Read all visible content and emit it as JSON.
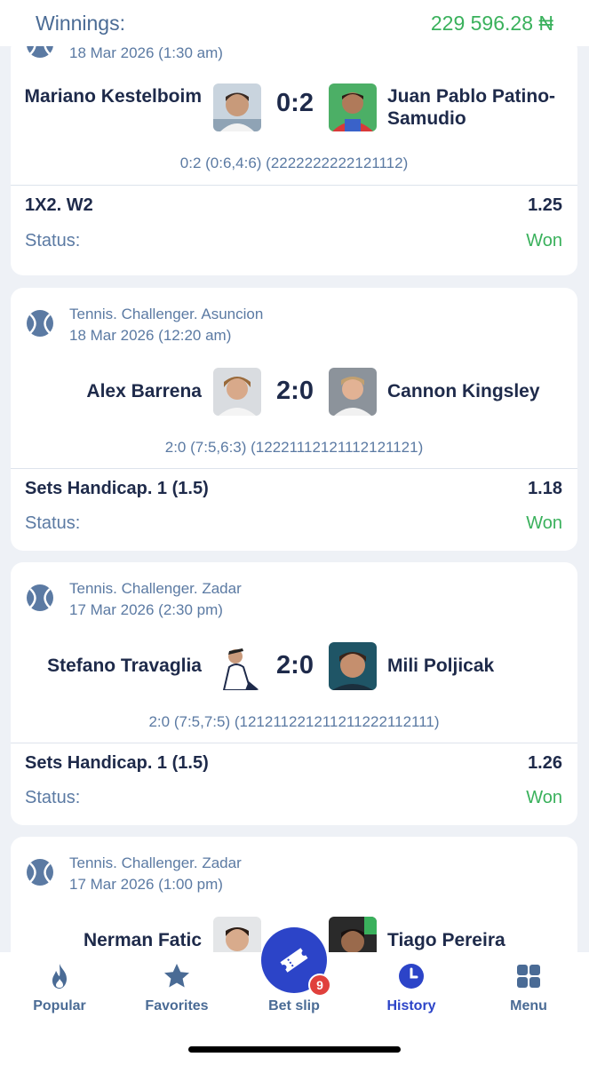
{
  "header": {
    "winnings_label": "Winnings:",
    "winnings_amount": "229 596.28 ₦"
  },
  "bets": [
    {
      "league": "",
      "date": "18 Mar 2026 (1:30 am)",
      "team1": "Mariano Kestelboim",
      "team2": "Juan Pablo Patino-Samudio",
      "score": "0:2",
      "details": "0:2 (0:6,4:6) (2222222222121112)",
      "market": "1X2. W2",
      "odds": "1.25",
      "status_label": "Status:",
      "status_value": "Won"
    },
    {
      "league": "Tennis. Challenger. Asuncion",
      "date": "18 Mar 2026 (12:20 am)",
      "team1": "Alex Barrena",
      "team2": "Cannon Kingsley",
      "score": "2:0",
      "details": "2:0 (7:5,6:3) (12221112121112121121)",
      "market": "Sets Handicap. 1 (1.5)",
      "odds": "1.18",
      "status_label": "Status:",
      "status_value": "Won"
    },
    {
      "league": "Tennis. Challenger. Zadar",
      "date": "17 Mar 2026 (2:30 pm)",
      "team1": "Stefano Travaglia",
      "team2": "Mili Poljicak",
      "score": "2:0",
      "details": "2:0 (7:5,7:5) (121211221211211222112111)",
      "market": "Sets Handicap. 1 (1.5)",
      "odds": "1.26",
      "status_label": "Status:",
      "status_value": "Won"
    },
    {
      "league": "Tennis. Challenger. Zadar",
      "date": "17 Mar 2026 (1:00 pm)",
      "team1": "Nerman Fatic",
      "team2": "Tiago Pereira"
    }
  ],
  "tabbar": {
    "popular": "Popular",
    "favorites": "Favorites",
    "betslip": "Bet slip",
    "betslip_count": "9",
    "history": "History",
    "menu": "Menu"
  },
  "colors": {
    "accent": "#2c44c8",
    "win": "#3ab15c",
    "muted": "#5b7aa3",
    "badge": "#e0403c"
  },
  "icons": [
    "tennis-ball-icon",
    "fire-icon",
    "star-icon",
    "ticket-icon",
    "clock-icon",
    "grid-menu-icon"
  ]
}
